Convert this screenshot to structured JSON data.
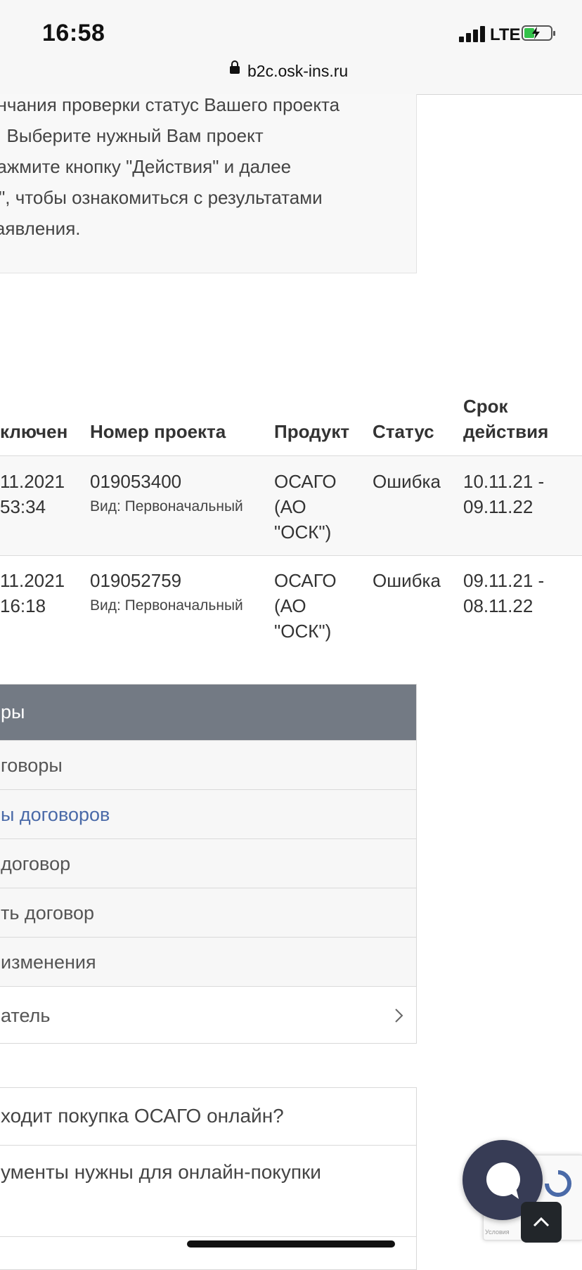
{
  "status_bar": {
    "time": "16:58",
    "network": "LTE",
    "url": "b2c.osk-ins.ru"
  },
  "info_text": [
    "ончания проверки статус Вашего проекта",
    "я. Выберите нужный Вам проект",
    " нажмите кнопку \"Действия\" и далее",
    "Ь\", чтобы ознакомиться с результатами",
    " заявления."
  ],
  "table": {
    "headers": {
      "concluded": "ключен",
      "project_number": "Номер проекта",
      "product": "Продукт",
      "status": "Статус",
      "validity_1": "Срок",
      "validity_2": "действия"
    },
    "rows": [
      {
        "date": "11.2021",
        "time": "53:34",
        "number": "019053400",
        "kind": "Вид: Первоначальный",
        "product_1": "ОСАГО",
        "product_2": "(АО",
        "product_3": "\"ОСК\")",
        "status": "Ошибка",
        "period_1": "10.11.21 -",
        "period_2": "09.11.22"
      },
      {
        "date": "11.2021",
        "time": "16:18",
        "number": "019052759",
        "kind": "Вид: Первоначальный",
        "product_1": "ОСАГО",
        "product_2": "(АО",
        "product_3": "\"ОСК\")",
        "status": "Ошибка",
        "period_1": "09.11.21 -",
        "period_2": "08.11.22"
      }
    ]
  },
  "menu": {
    "header": "ры",
    "items": [
      {
        "label": "говоры"
      },
      {
        "label": "ы договоров"
      },
      {
        "label": "договор"
      },
      {
        "label": "ть договор"
      },
      {
        "label": "изменения"
      },
      {
        "label": "атель"
      }
    ]
  },
  "faq": [
    {
      "label": "ходит покупка ОСАГО онлайн?"
    },
    {
      "label": "ументы нужны для онлайн-покупки"
    }
  ],
  "recaptcha_text": "Условия",
  "colors": {
    "menu_header": "#737a84",
    "menu_active_link": "#4a6aa8",
    "chat_bubble": "#373c55",
    "battery_green": "#33c24a"
  },
  "icons": [
    "lock-icon",
    "chevron-right-icon",
    "chat-icon",
    "arrow-up-icon"
  ]
}
